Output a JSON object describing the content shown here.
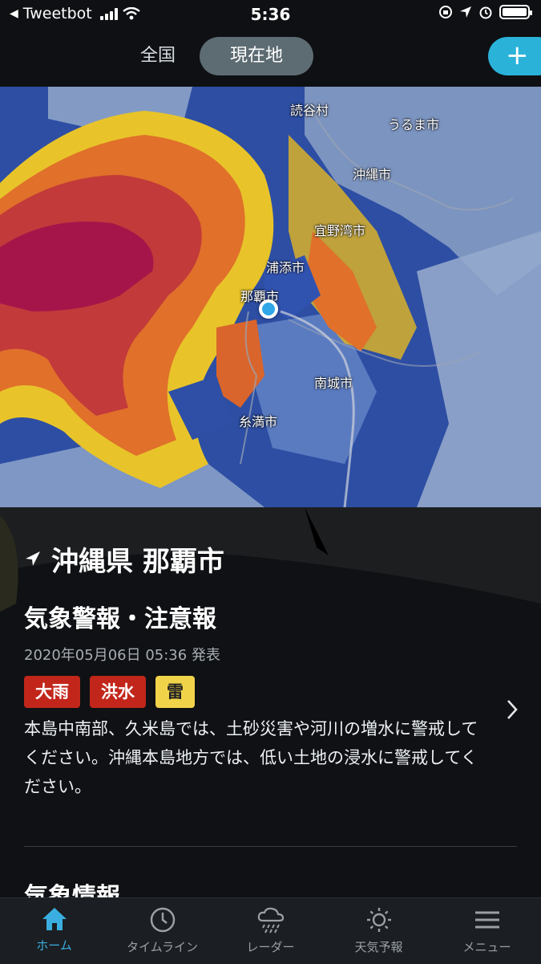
{
  "status_bar": {
    "back_app": "Tweetbot",
    "time": "5:36",
    "icons": [
      "signal-icon",
      "wifi-icon",
      "rotation-lock-icon",
      "location-icon",
      "alarm-icon",
      "battery-icon"
    ]
  },
  "header": {
    "tabs": [
      {
        "label": "全国",
        "active": false
      },
      {
        "label": "現在地",
        "active": true
      }
    ],
    "add_label": "+"
  },
  "map": {
    "labels": [
      "読谷村",
      "うるま市",
      "沖縄市",
      "宜野湾市",
      "浦添市",
      "那覇市",
      "南城市",
      "糸満市"
    ]
  },
  "location": {
    "title": "沖縄県 那覇市"
  },
  "warnings": {
    "title": "気象警報・注意報",
    "issued": "2020年05月06日 05:36 発表",
    "badges": [
      {
        "label": "大雨",
        "color": "#c2261b"
      },
      {
        "label": "洪水",
        "color": "#c2261b"
      },
      {
        "label": "雷",
        "color": "#f1d34a"
      }
    ],
    "description": "本島中南部、久米島では、土砂災害や河川の増水に警戒してください。沖縄本島地方では、低い土地の浸水に警戒してください。"
  },
  "next_section": {
    "title": "気象情報"
  },
  "tabbar": {
    "items": [
      {
        "label": "ホーム",
        "icon": "home-icon",
        "active": true
      },
      {
        "label": "タイムライン",
        "icon": "clock-icon",
        "active": false
      },
      {
        "label": "レーダー",
        "icon": "rain-cloud-icon",
        "active": false
      },
      {
        "label": "天気予報",
        "icon": "sun-icon",
        "active": false
      },
      {
        "label": "メニュー",
        "icon": "menu-icon",
        "active": false
      }
    ]
  }
}
